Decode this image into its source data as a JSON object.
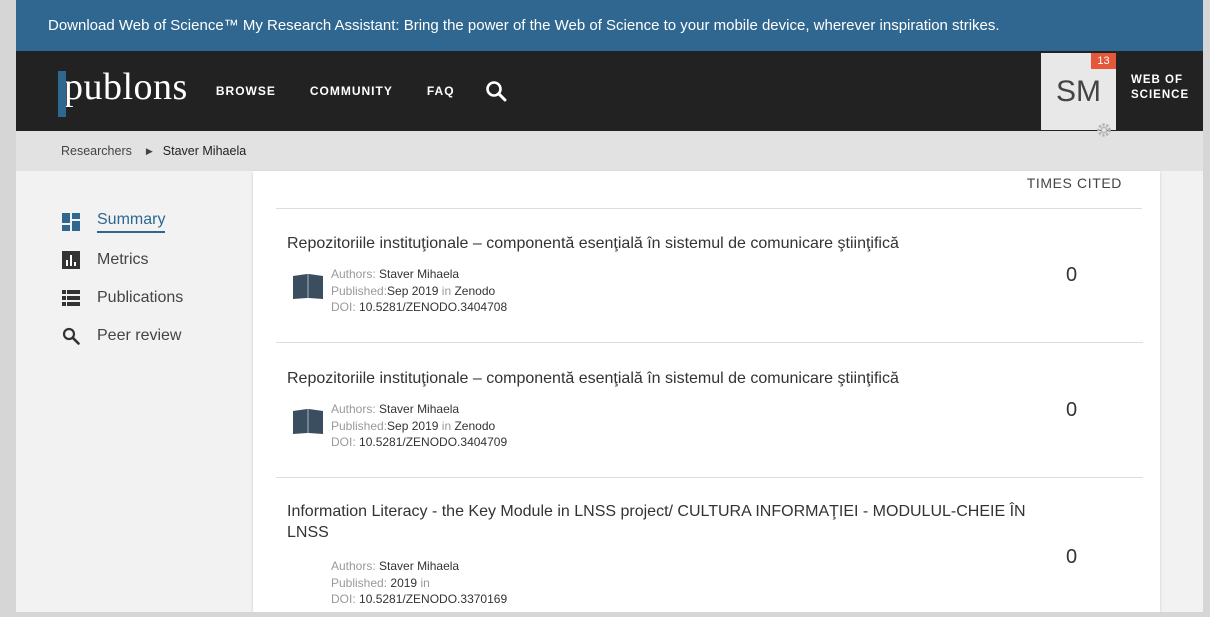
{
  "promo": {
    "text": "Download Web of Science™ My Research Assistant: Bring the power of the Web of Science to your mobile device, wherever inspiration strikes."
  },
  "nav": {
    "logo": "publons",
    "links": [
      "BROWSE",
      "COMMUNITY",
      "FAQ"
    ],
    "user_initials": "SM",
    "notification_count": "13",
    "wos_line1": "WEB OF",
    "wos_line2": "SCIENCE"
  },
  "breadcrumb": {
    "parent": "Researchers",
    "current": "Staver Mihaela"
  },
  "sidebar": {
    "items": [
      {
        "label": "Summary",
        "icon": "dashboard-icon",
        "active": true
      },
      {
        "label": "Metrics",
        "icon": "bar-chart-icon",
        "active": false
      },
      {
        "label": "Publications",
        "icon": "list-icon",
        "active": false
      },
      {
        "label": "Peer review",
        "icon": "search-icon",
        "active": false
      }
    ]
  },
  "publications": {
    "times_cited_header": "TIMES CITED",
    "authors_label": "Authors:",
    "published_label": "Published:",
    "in_label": "in",
    "doi_label": "DOI:",
    "items": [
      {
        "title": "Repozitoriile instituţionale – componentă esenţială în sistemul de comunicare ştiinţifică",
        "authors": "Staver Mihaela",
        "date": "Sep 2019",
        "venue": "Zenodo",
        "doi": "10.5281/ZENODO.3404708",
        "times_cited": "0",
        "icon": "book-icon"
      },
      {
        "title": "Repozitoriile instituţionale – componentă esenţială în sistemul de comunicare ştiinţifică",
        "authors": "Staver Mihaela",
        "date": "Sep 2019",
        "venue": "Zenodo",
        "doi": "10.5281/ZENODO.3404709",
        "times_cited": "0",
        "icon": "book-icon"
      },
      {
        "title": "Information Literacy - the Key Module in LNSS project/ CULTURA INFORMAŢIEI - MODULUL-CHEIE ÎN LNSS",
        "authors": "Staver Mihaela",
        "date": "2019",
        "venue": "",
        "doi": "10.5281/ZENODO.3370169",
        "times_cited": "0",
        "icon": ""
      }
    ]
  }
}
